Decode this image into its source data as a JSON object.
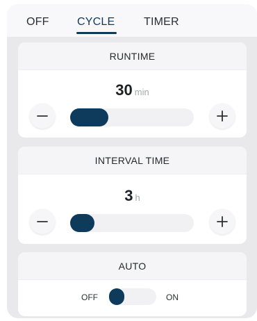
{
  "tabs": [
    {
      "label": "OFF"
    },
    {
      "label": "CYCLE"
    },
    {
      "label": "TIMER"
    }
  ],
  "active_tab": "CYCLE",
  "runtime": {
    "title": "RUNTIME",
    "value": "30",
    "unit": "min",
    "slider_fraction": 0.25
  },
  "interval": {
    "title": "INTERVAL TIME",
    "value": "3",
    "unit": "h",
    "slider_fraction": 0.1
  },
  "auto": {
    "title": "AUTO",
    "off_label": "OFF",
    "on_label": "ON",
    "state": "off"
  },
  "colors": {
    "accent": "#0e3a5c",
    "panel": "#e9e9ec",
    "track": "#f1f1f4"
  },
  "icons": {
    "decrement": "minus-icon",
    "increment": "plus-icon"
  }
}
